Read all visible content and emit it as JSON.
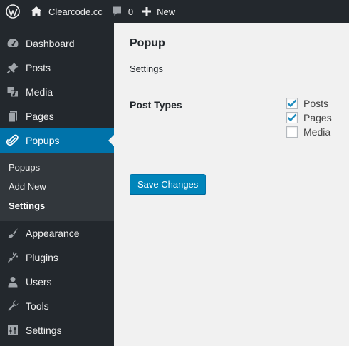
{
  "adminbar": {
    "site_name": "Clearcode.cc",
    "comments_count": "0",
    "new_label": "New"
  },
  "sidebar": {
    "items_top": [
      {
        "label": "Dashboard",
        "icon": "dashboard-icon"
      },
      {
        "label": "Posts",
        "icon": "pushpin-icon"
      },
      {
        "label": "Media",
        "icon": "media-icon"
      },
      {
        "label": "Pages",
        "icon": "pages-icon"
      }
    ],
    "current": {
      "label": "Popups",
      "icon": "paperclip-icon"
    },
    "submenu": [
      "Popups",
      "Add New",
      "Settings"
    ],
    "items_bottom": [
      {
        "label": "Appearance",
        "icon": "paintbrush-icon"
      },
      {
        "label": "Plugins",
        "icon": "plugin-icon"
      },
      {
        "label": "Users",
        "icon": "user-icon"
      },
      {
        "label": "Tools",
        "icon": "wrench-icon"
      },
      {
        "label": "Settings",
        "icon": "settings-sliders-icon"
      }
    ],
    "accent_color": "#0073aa",
    "background_color": "#23282d"
  },
  "main": {
    "title": "Popup",
    "subtitle": "Settings",
    "field_label": "Post Types",
    "options": [
      {
        "label": "Posts",
        "checked": true
      },
      {
        "label": "Pages",
        "checked": true
      },
      {
        "label": "Media",
        "checked": false
      }
    ],
    "save_label": "Save Changes",
    "button_color": "#0085ba"
  }
}
